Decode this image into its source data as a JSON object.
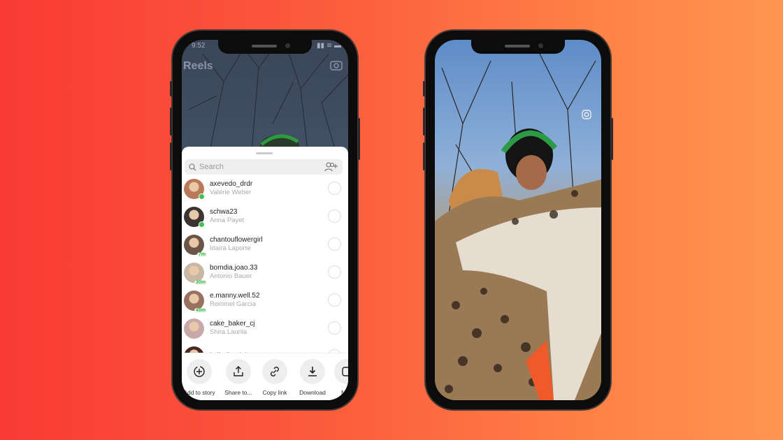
{
  "left_phone": {
    "status_time": "9:52",
    "header_title": "Reels",
    "search": {
      "placeholder": "Search"
    },
    "contacts": [
      {
        "username": "axevedo_drdr",
        "name": "Valérie Weber",
        "status": "online",
        "avatar_color": "#b97a5a"
      },
      {
        "username": "schwa23",
        "name": "Anna Payet",
        "status": "online",
        "avatar_color": "#3a3530"
      },
      {
        "username": "chantouflowergirl",
        "name": "Idaira Laporte",
        "status": "7m",
        "avatar_color": "#6b5448"
      },
      {
        "username": "bomdia.joao.33",
        "name": "Antonio Bauer",
        "status": "30m",
        "avatar_color": "#c9b7a6"
      },
      {
        "username": "e.manny.well.52",
        "name": "Rommel Garcia",
        "status": "45m",
        "avatar_color": "#9a7060"
      },
      {
        "username": "cake_baker_cj",
        "name": "Shira Laurila",
        "status": "",
        "avatar_color": "#c8a8a8"
      },
      {
        "username": "kalindi_rainbows",
        "name": "",
        "status": "",
        "avatar_color": "#4a2a22"
      }
    ],
    "actions": [
      {
        "label": "Add to story",
        "icon": "add-story-icon"
      },
      {
        "label": "Share to...",
        "icon": "share-icon"
      },
      {
        "label": "Copy link",
        "icon": "link-icon"
      },
      {
        "label": "Download",
        "icon": "download-icon"
      },
      {
        "label": "Mes",
        "icon": "message-icon"
      }
    ]
  },
  "right_phone": {
    "watermark_icon": "instagram-icon"
  },
  "colors": {
    "online": "#3ec24c",
    "bg_left": "#f93a35",
    "bg_right": "#ff9550"
  }
}
